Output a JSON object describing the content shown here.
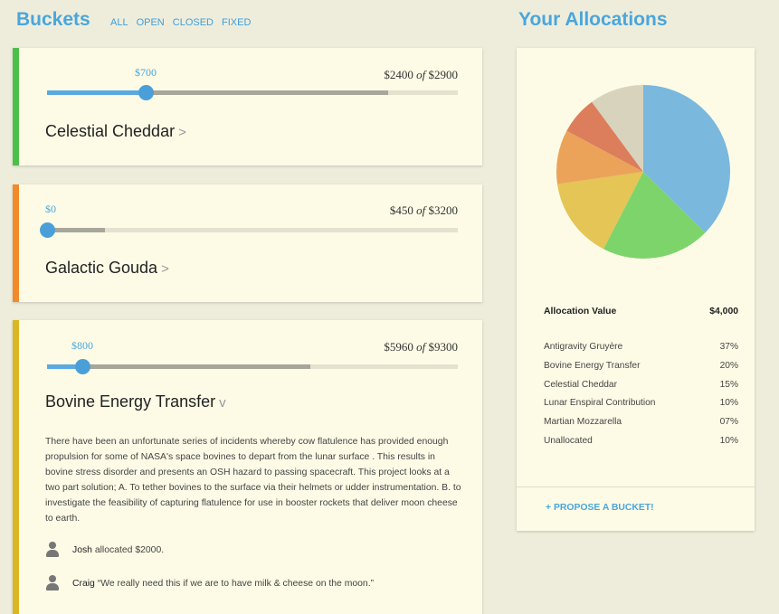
{
  "header": {
    "buckets_title": "Buckets",
    "filters": [
      "ALL",
      "OPEN",
      "CLOSED",
      "FIXED"
    ],
    "allocations_title": "Your Allocations"
  },
  "buckets": [
    {
      "name": "Celestial Cheddar",
      "my_allocation": "$700",
      "funded": "$2400",
      "of_word": "of",
      "target": "$2900",
      "stripe_color": "#4cbf4a",
      "chevron": ">",
      "my_fraction": 0.24,
      "funded_fraction": 0.83
    },
    {
      "name": "Galactic Gouda",
      "my_allocation": "$0",
      "funded": "$450",
      "of_word": "of",
      "target": "$3200",
      "stripe_color": "#f28a2a",
      "chevron": ">",
      "my_fraction": 0.0,
      "funded_fraction": 0.14
    },
    {
      "name": "Bovine Energy Transfer",
      "my_allocation": "$800",
      "funded": "$5960",
      "of_word": "of",
      "target": "$9300",
      "stripe_color": "#d9b623",
      "chevron": "v",
      "my_fraction": 0.086,
      "funded_fraction": 0.64,
      "description": "There have been an unfortunate series of incidents whereby cow flatulence has provided enough propulsion for some of NASA's space bovines to depart from the lunar surface . This results in bovine stress disorder and presents an OSH hazard to passing spacecraft. This project looks at a two part solution; A. To tether bovines to the surface via their helmets or udder instrumentation. B. to investigate the feasibility of capturing flatulence for use in booster rockets that deliver moon cheese to earth.",
      "comments": [
        {
          "user": "Josh",
          "text": "allocated $2000."
        },
        {
          "user": "Craig",
          "text": "“We really need this if we are to have milk & cheese on the moon.”"
        }
      ]
    }
  ],
  "allocations": {
    "value_label": "Allocation Value",
    "value": "$4,000",
    "items": [
      {
        "name": "Antigravity Gruyère",
        "pct": "37%",
        "color": "#7ab8de"
      },
      {
        "name": "Bovine Energy Transfer",
        "pct": "20%",
        "color": "#7dd46a"
      },
      {
        "name": "Celestial Cheddar",
        "pct": "15%",
        "color": "#e4c556"
      },
      {
        "name": "Lunar Enspiral Contribution",
        "pct": "10%",
        "color": "#eba359"
      },
      {
        "name": "Martian Mozzarella",
        "pct": "07%",
        "color": "#dc7e5c"
      },
      {
        "name": "Unallocated",
        "pct": "10%",
        "color": "#d8d3bd"
      }
    ],
    "propose_label": "+ PROPOSE A BUCKET!"
  }
}
